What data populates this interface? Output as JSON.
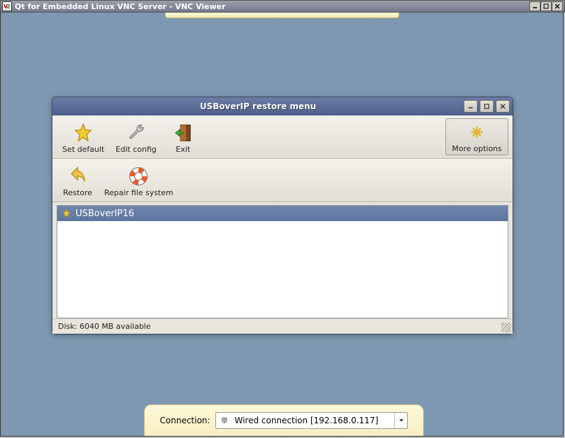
{
  "outer_window": {
    "title": "Qt for Embedded Linux VNC Server - VNC Viewer"
  },
  "inner_window": {
    "title": "USBoverIP restore menu"
  },
  "toolbar_primary": {
    "set_default": "Set default",
    "edit_config": "Edit config",
    "exit": "Exit",
    "more_options": "More options"
  },
  "toolbar_secondary": {
    "restore": "Restore",
    "repair_fs": "Repair file system"
  },
  "list": {
    "items": [
      {
        "label": "USBoverIP16"
      }
    ]
  },
  "status_bar": {
    "disk_text": "Disk: 6040 MB available"
  },
  "connection_panel": {
    "label": "Connection:",
    "selected": "Wired connection [192.168.0.117]"
  }
}
